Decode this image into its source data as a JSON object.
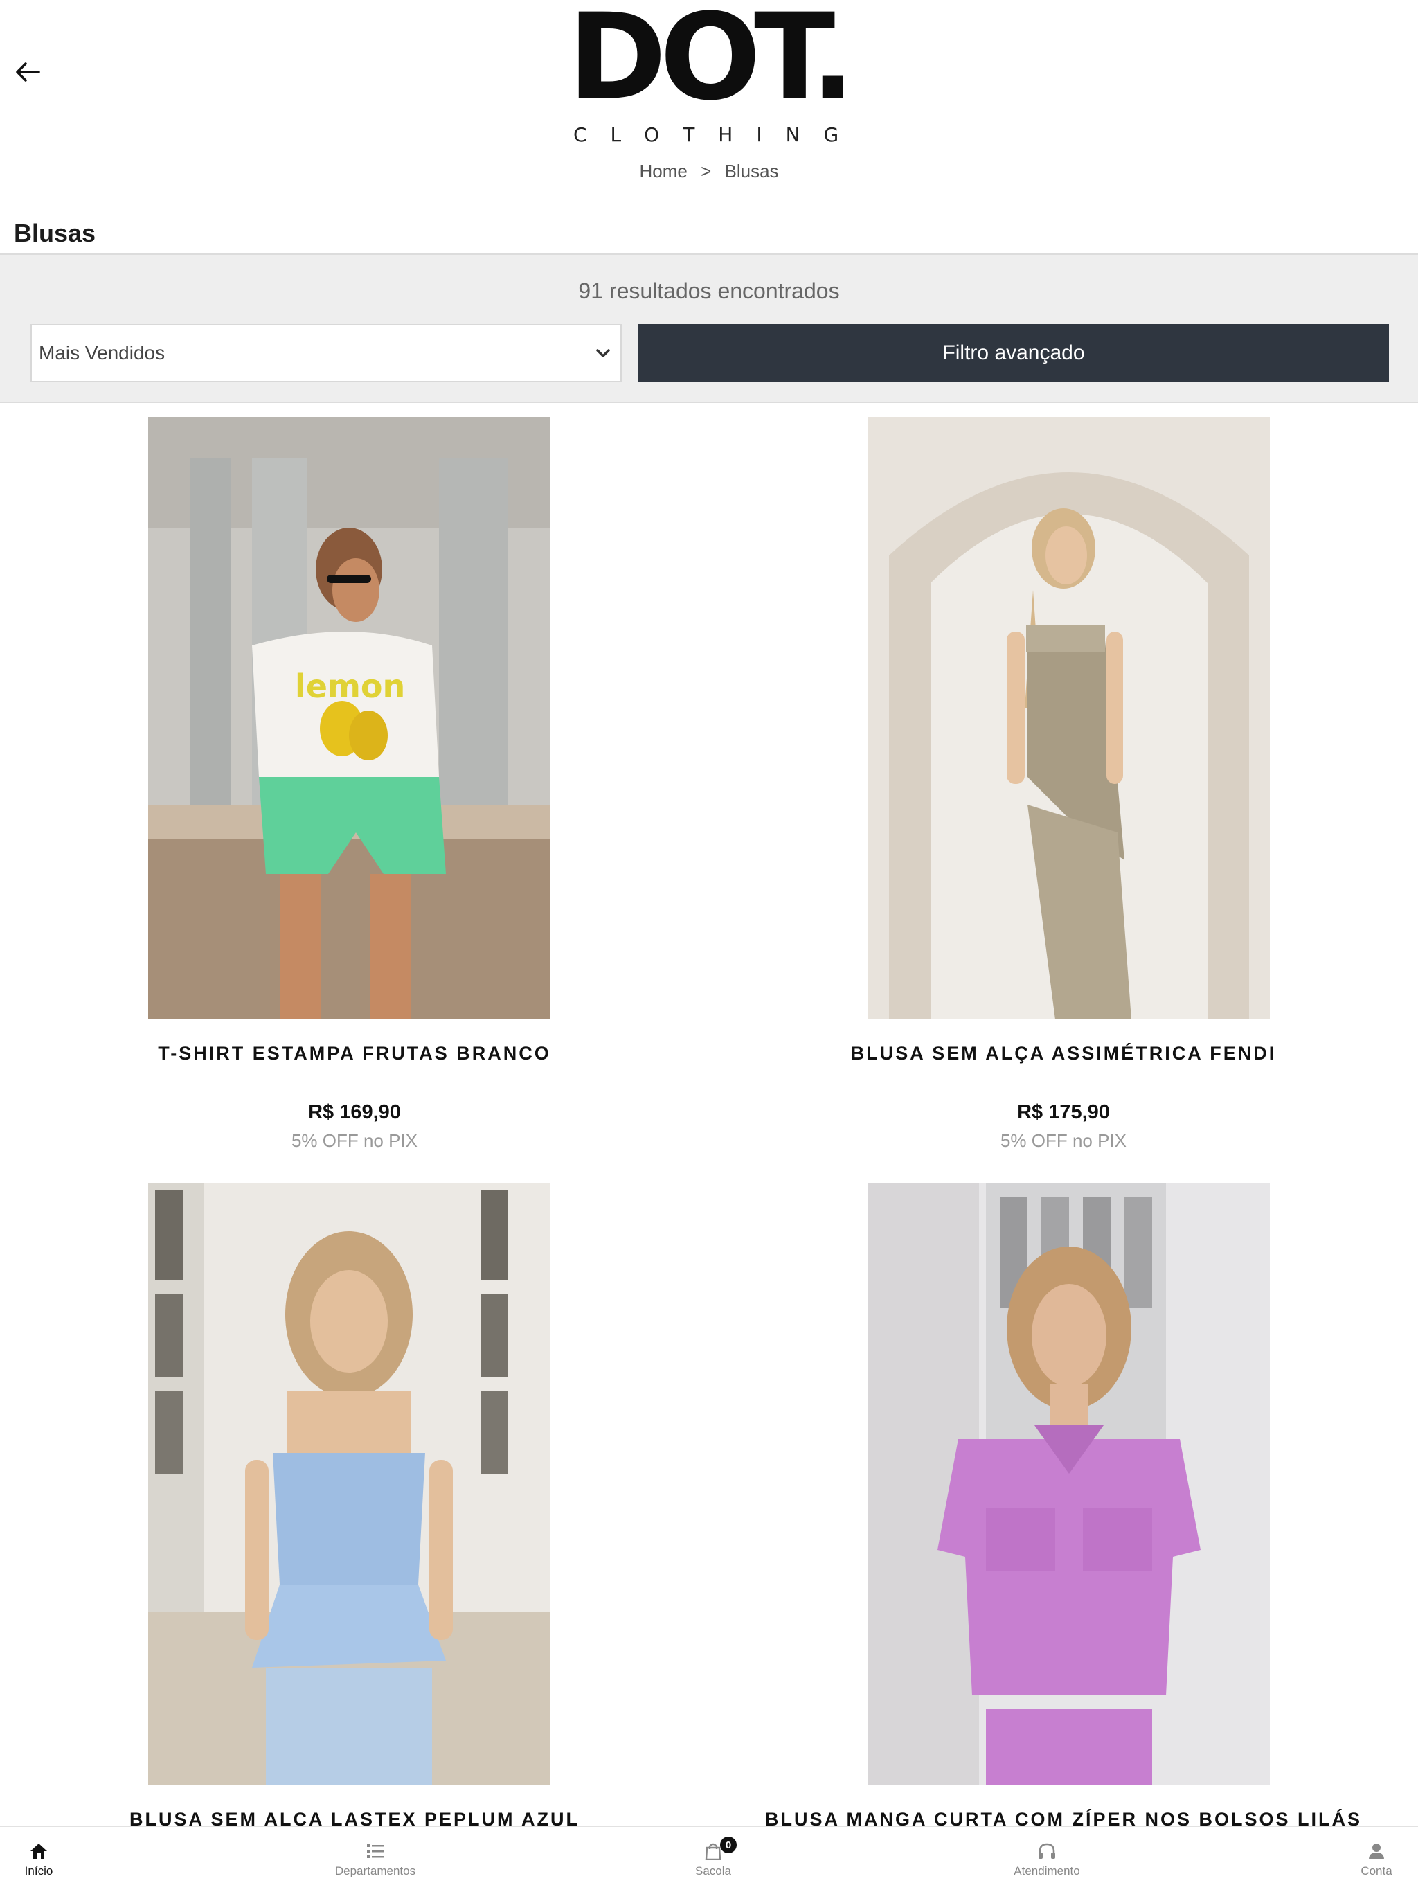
{
  "header": {
    "logo_main": "DOT.",
    "logo_sub": "CLOTHING",
    "breadcrumb": {
      "home": "Home",
      "separator": ">",
      "current": "Blusas"
    }
  },
  "page": {
    "title": "Blusas"
  },
  "filters": {
    "results_count": "91 resultados encontrados",
    "sort_selected": "Mais Vendidos",
    "advanced_filter_label": "Filtro avançado"
  },
  "products": [
    {
      "name": "T-SHIRT ESTAMPA FRUTAS BRANCO",
      "price": "R$ 169,90",
      "pix_discount": "5% OFF no PIX"
    },
    {
      "name": "BLUSA SEM ALÇA ASSIMÉTRICA FENDI",
      "price": "R$ 175,90",
      "pix_discount": "5% OFF no PIX"
    },
    {
      "name": "BLUSA SEM ALÇA LASTEX PEPLUM AZUL"
    },
    {
      "name": "BLUSA MANGA CURTA COM ZÍPER NOS BOLSOS LILÁS"
    }
  ],
  "bottom_nav": {
    "items": [
      {
        "label": "Início",
        "icon": "home-icon",
        "active": true
      },
      {
        "label": "Departamentos",
        "icon": "list-icon"
      },
      {
        "label": "Sacola",
        "icon": "bag-icon",
        "badge": "0"
      },
      {
        "label": "Atendimento",
        "icon": "headphones-icon"
      },
      {
        "label": "Conta",
        "icon": "user-icon"
      }
    ]
  },
  "colors": {
    "filter_button_bg": "#2f3640",
    "panel_bg": "#eeeeee",
    "pix_text": "#999999"
  }
}
